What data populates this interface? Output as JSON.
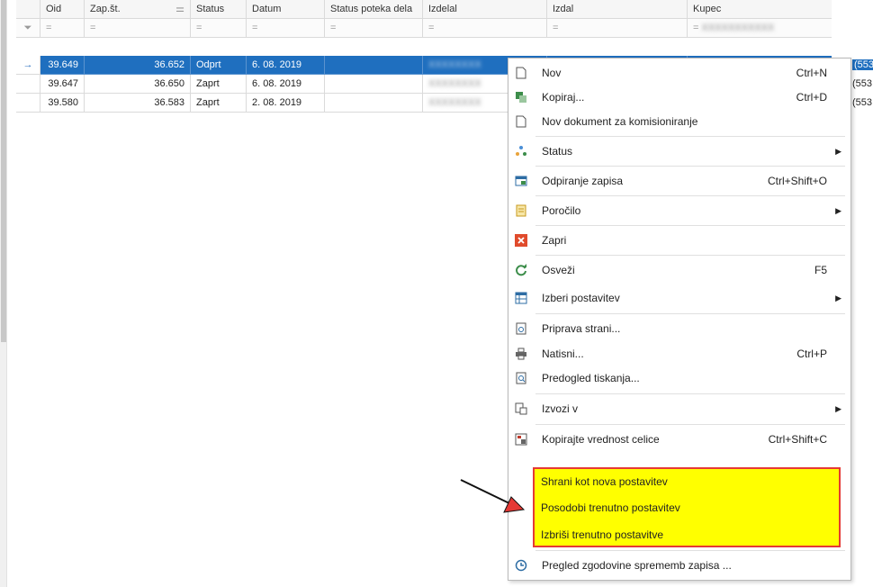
{
  "columns": [
    "Oid",
    "Zap.št.",
    "Status",
    "Datum",
    "Status poteka dela",
    "Izdelal",
    "Izdal",
    "Kupec"
  ],
  "filter_symbol": "=",
  "rows": [
    {
      "oid": "39.649",
      "zap": "36.652",
      "status": "Odprt",
      "datum": "6. 08. 2019",
      "izdelal": "",
      "izdal": "",
      "kupec": "",
      "kupec_tail": "(553"
    },
    {
      "oid": "39.647",
      "zap": "36.650",
      "status": "Zaprt",
      "datum": "6. 08. 2019",
      "izdelal": "",
      "izdal": "",
      "kupec": "",
      "kupec_tail": "(553"
    },
    {
      "oid": "39.580",
      "zap": "36.583",
      "status": "Zaprt",
      "datum": "2. 08. 2019",
      "izdelal": "",
      "izdal": "",
      "kupec": "",
      "kupec_tail": "(553"
    }
  ],
  "menu": {
    "nov": {
      "label": "Nov",
      "shortcut": "Ctrl+N"
    },
    "kopiraj": {
      "label": "Kopiraj...",
      "shortcut": "Ctrl+D"
    },
    "nov_dok": {
      "label": "Nov dokument za komisioniranje"
    },
    "status": {
      "label": "Status"
    },
    "odpiranje": {
      "label": "Odpiranje zapisa",
      "shortcut": "Ctrl+Shift+O"
    },
    "porocilo": {
      "label": "Poročilo"
    },
    "zapri": {
      "label": "Zapri"
    },
    "osvezi": {
      "label": "Osveži",
      "shortcut": "F5"
    },
    "izberi": {
      "label": "Izberi postavitev"
    },
    "priprava": {
      "label": "Priprava strani..."
    },
    "natisni": {
      "label": "Natisni...",
      "shortcut": "Ctrl+P"
    },
    "predogled": {
      "label": "Predogled tiskanja..."
    },
    "izvozi": {
      "label": "Izvozi v"
    },
    "kopirajte": {
      "label": "Kopirajte vrednost celice",
      "shortcut": "Ctrl+Shift+C"
    },
    "shrani": {
      "label": "Shrani kot nova postavitev"
    },
    "posodobi": {
      "label": "Posodobi trenutno postavitev"
    },
    "izbrisi": {
      "label": "Izbriši trenutno postavitve"
    },
    "pregled": {
      "label": "Pregled zgodovine sprememb zapisa ..."
    }
  },
  "colors": {
    "selection": "#1f6fbf",
    "highlight": "#ffff00",
    "highlight_border": "#e53935",
    "arrow_head": "#e53935"
  }
}
